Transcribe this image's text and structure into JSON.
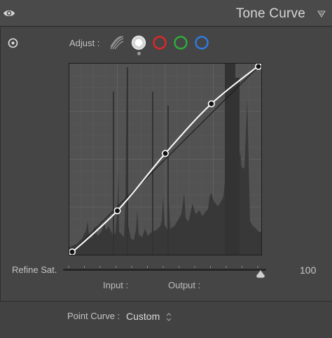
{
  "header": {
    "title": "Tone Curve"
  },
  "adjust": {
    "label": "Adjust :",
    "channels": [
      {
        "name": "parametric",
        "icon": "parametric-curve-icon",
        "selected": false
      },
      {
        "name": "point-rgb",
        "icon": "white-circle-icon",
        "color": "#ffffff",
        "selected": true
      },
      {
        "name": "red",
        "icon": "red-circle-icon",
        "color": "#e2262a",
        "selected": false
      },
      {
        "name": "green",
        "icon": "green-circle-icon",
        "color": "#2fae3a",
        "selected": false
      },
      {
        "name": "blue",
        "icon": "blue-circle-icon",
        "color": "#2f7be4",
        "selected": false
      }
    ]
  },
  "curve": {
    "points": [
      [
        0,
        0
      ],
      [
        25,
        23
      ],
      [
        50,
        53
      ],
      [
        74,
        79
      ],
      [
        100,
        100
      ]
    ]
  },
  "refine": {
    "label": "Refine Sat.",
    "value": "100",
    "level": 100
  },
  "readout": {
    "input_label": "Input :",
    "output_label": "Output :"
  },
  "point_curve": {
    "label": "Point Curve :",
    "value": "Custom"
  },
  "colors": {
    "panel": "#454545",
    "header": "#4a4a4a",
    "graph_bg": "#525252",
    "histogram": "#383838",
    "curve": "#ffffff"
  }
}
